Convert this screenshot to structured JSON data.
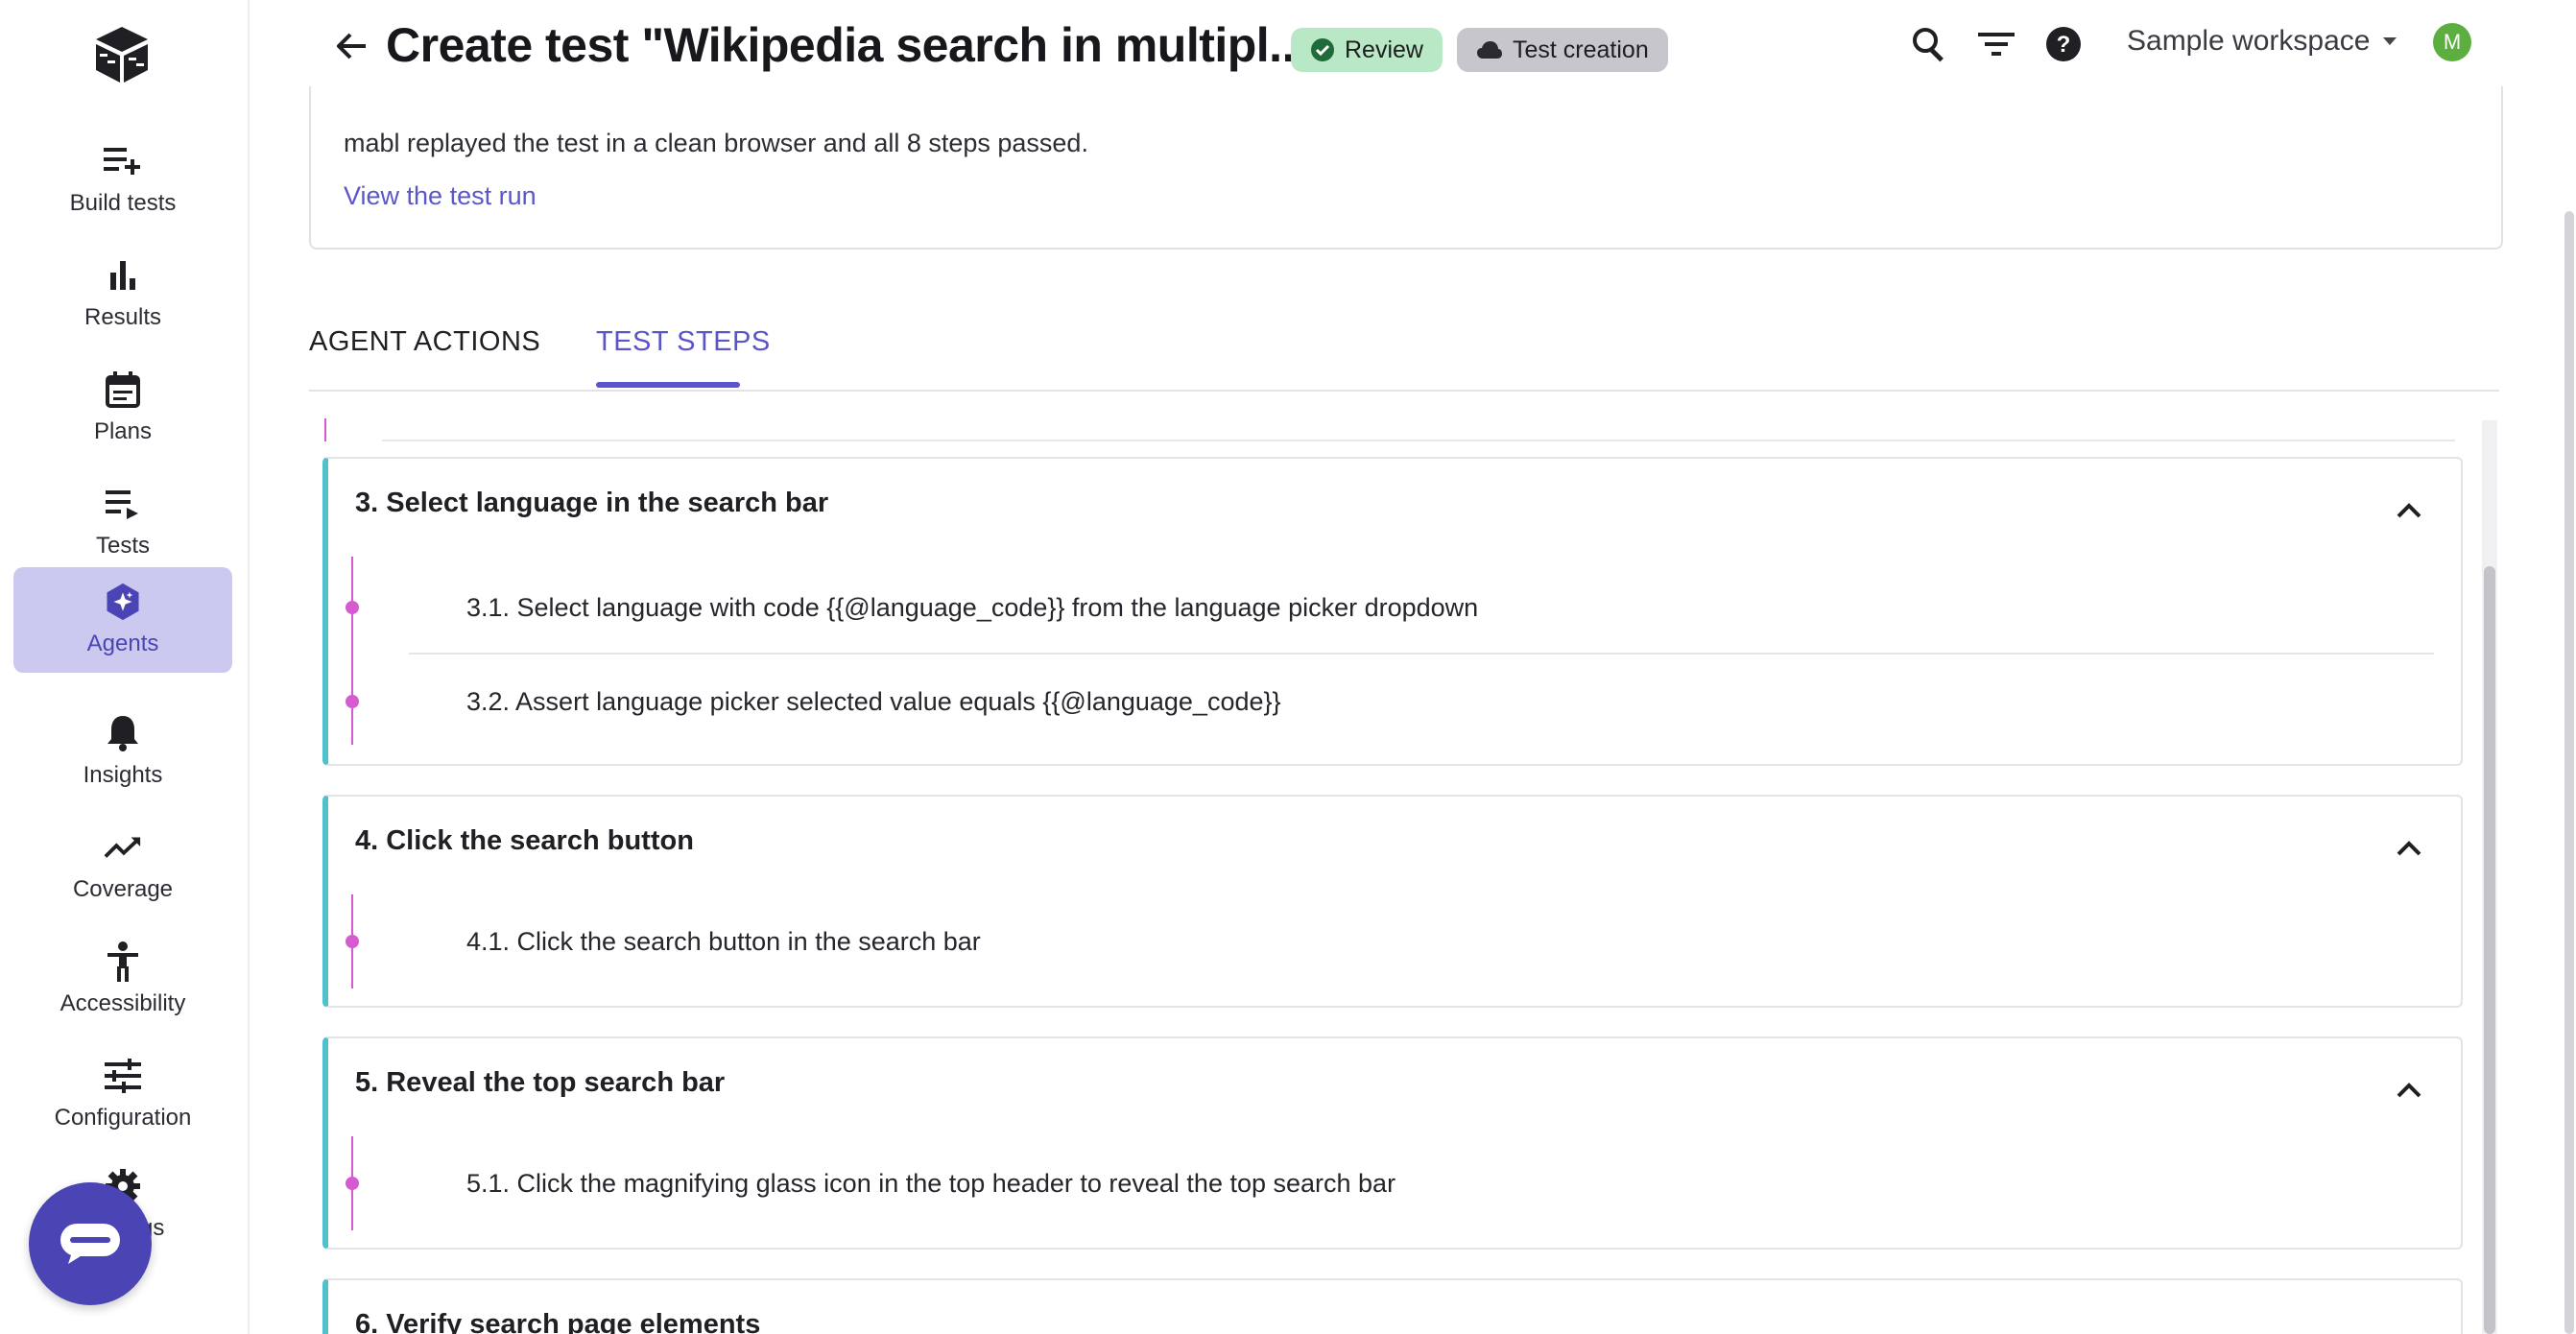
{
  "sidebar": {
    "items": [
      {
        "label": "Build tests",
        "icon": "playlist-add-icon"
      },
      {
        "label": "Results",
        "icon": "bar-chart-icon"
      },
      {
        "label": "Plans",
        "icon": "calendar-icon"
      },
      {
        "label": "Tests",
        "icon": "playlist-play-icon"
      },
      {
        "label": "Agents",
        "icon": "agent-sparkle-icon",
        "active": true
      },
      {
        "label": "Insights",
        "icon": "bell-icon"
      },
      {
        "label": "Coverage",
        "icon": "trending-up-icon"
      },
      {
        "label": "Accessibility",
        "icon": "accessibility-icon"
      },
      {
        "label": "Configuration",
        "icon": "tune-icon"
      },
      {
        "label": "Settings",
        "icon": "gear-icon"
      }
    ]
  },
  "header": {
    "title": "Create test \"Wikipedia search in multipl...",
    "badges": {
      "review": "Review",
      "creation": "Test creation"
    },
    "workspace": "Sample workspace",
    "avatar_initial": "M"
  },
  "result": {
    "message": "mabl replayed the test in a clean browser and all 8 steps passed.",
    "link": "View the test run"
  },
  "tabs": {
    "agent_actions": "AGENT ACTIONS",
    "test_steps": "TEST STEPS"
  },
  "steps": [
    {
      "title": "3. Select language in the search bar",
      "substeps": [
        "3.1. Select language with code {{@language_code}} from the language picker dropdown",
        "3.2. Assert language picker selected value equals {{@language_code}}"
      ]
    },
    {
      "title": "4. Click the search button",
      "substeps": [
        "4.1. Click the search button in the search bar"
      ]
    },
    {
      "title": "5. Reveal the top search bar",
      "substeps": [
        "5.1. Click the magnifying glass icon in the top header to reveal the top search bar"
      ]
    },
    {
      "title": "6. Verify search page elements",
      "substeps": []
    }
  ],
  "colors": {
    "accent": "#5a55c8",
    "step_border": "#4fc1cc",
    "timeline": "#d65bd0",
    "review_bg": "#b9e8c7"
  }
}
